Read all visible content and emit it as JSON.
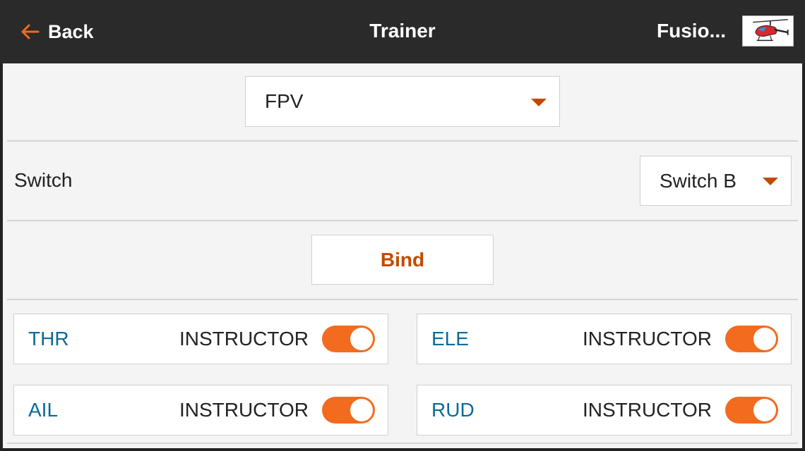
{
  "header": {
    "back_label": "Back",
    "title": "Trainer",
    "model_name": "Fusio...",
    "model_image_icon": "helicopter-icon"
  },
  "mode_select": {
    "value": "FPV"
  },
  "switch_row": {
    "label": "Switch",
    "value": "Switch B"
  },
  "bind": {
    "label": "Bind"
  },
  "channels": [
    {
      "name": "THR",
      "mode": "INSTRUCTOR",
      "enabled": true
    },
    {
      "name": "ELE",
      "mode": "INSTRUCTOR",
      "enabled": true
    },
    {
      "name": "AIL",
      "mode": "INSTRUCTOR",
      "enabled": true
    },
    {
      "name": "RUD",
      "mode": "INSTRUCTOR",
      "enabled": true
    }
  ],
  "colors": {
    "accent": "#f26b1f",
    "accent_dark": "#c24a00",
    "channel_text": "#0a6a9a",
    "header_bg": "#2a2a2a",
    "content_bg": "#f4f4f4"
  }
}
